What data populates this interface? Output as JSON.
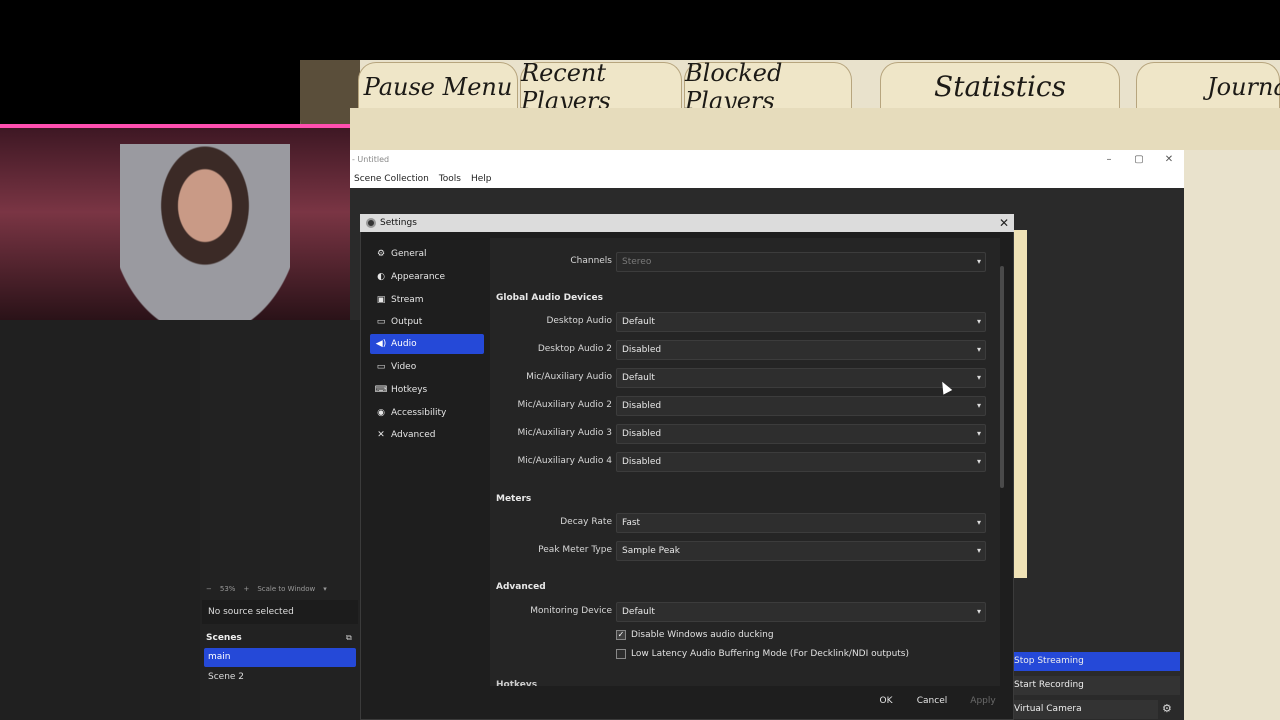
{
  "game": {
    "tabs": [
      "Pause Menu",
      "Recent Players",
      "Blocked Players",
      "Statistics",
      "Journal"
    ]
  },
  "obs": {
    "window_title": "- Untitled",
    "menu": [
      "Scene Collection",
      "Tools",
      "Help"
    ],
    "zoom": "53%",
    "zoom_mode": "Scale to Window",
    "no_source": "No source selected",
    "scenes_header": "Scenes",
    "scenes": [
      "main",
      "Scene 2"
    ],
    "controls": {
      "stop_streaming": "Stop Streaming",
      "start_recording": "Start Recording",
      "virtual_camera": "Virtual Camera"
    }
  },
  "settings": {
    "title": "Settings",
    "nav": [
      {
        "label": "General",
        "icon": "gear-icon"
      },
      {
        "label": "Appearance",
        "icon": "brush-icon"
      },
      {
        "label": "Stream",
        "icon": "broadcast-icon"
      },
      {
        "label": "Output",
        "icon": "output-icon"
      },
      {
        "label": "Audio",
        "icon": "speaker-icon",
        "active": true
      },
      {
        "label": "Video",
        "icon": "monitor-icon"
      },
      {
        "label": "Hotkeys",
        "icon": "keyboard-icon"
      },
      {
        "label": "Accessibility",
        "icon": "accessibility-icon"
      },
      {
        "label": "Advanced",
        "icon": "wrench-icon"
      }
    ],
    "channels": {
      "label": "Channels",
      "value": "Stereo"
    },
    "global_audio": {
      "title": "Global Audio Devices",
      "fields": [
        {
          "label": "Desktop Audio",
          "value": "Default"
        },
        {
          "label": "Desktop Audio 2",
          "value": "Disabled"
        },
        {
          "label": "Mic/Auxiliary Audio",
          "value": "Default"
        },
        {
          "label": "Mic/Auxiliary Audio 2",
          "value": "Disabled"
        },
        {
          "label": "Mic/Auxiliary Audio 3",
          "value": "Disabled"
        },
        {
          "label": "Mic/Auxiliary Audio 4",
          "value": "Disabled"
        }
      ]
    },
    "meters": {
      "title": "Meters",
      "fields": [
        {
          "label": "Decay Rate",
          "value": "Fast"
        },
        {
          "label": "Peak Meter Type",
          "value": "Sample Peak"
        }
      ]
    },
    "advanced": {
      "title": "Advanced",
      "monitoring": {
        "label": "Monitoring Device",
        "value": "Default"
      },
      "checkboxes": [
        {
          "label": "Disable Windows audio ducking",
          "checked": true
        },
        {
          "label": "Low Latency Audio Buffering Mode (For Decklink/NDI outputs)",
          "checked": false
        }
      ]
    },
    "hotkeys_peek": "Hotkeys",
    "buttons": {
      "ok": "OK",
      "cancel": "Cancel",
      "apply": "Apply"
    }
  },
  "colors": {
    "accent": "#2549d8",
    "dialog_bg": "#1e1e1e",
    "content_bg": "#252525"
  }
}
